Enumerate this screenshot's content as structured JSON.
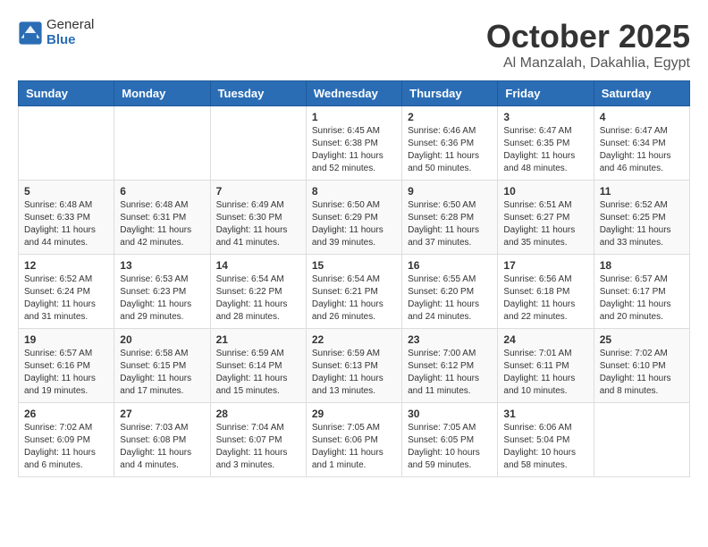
{
  "header": {
    "logo_general": "General",
    "logo_blue": "Blue",
    "month_title": "October 2025",
    "location": "Al Manzalah, Dakahlia, Egypt"
  },
  "days_of_week": [
    "Sunday",
    "Monday",
    "Tuesday",
    "Wednesday",
    "Thursday",
    "Friday",
    "Saturday"
  ],
  "weeks": [
    [
      {
        "day": "",
        "info": ""
      },
      {
        "day": "",
        "info": ""
      },
      {
        "day": "",
        "info": ""
      },
      {
        "day": "1",
        "info": "Sunrise: 6:45 AM\nSunset: 6:38 PM\nDaylight: 11 hours\nand 52 minutes."
      },
      {
        "day": "2",
        "info": "Sunrise: 6:46 AM\nSunset: 6:36 PM\nDaylight: 11 hours\nand 50 minutes."
      },
      {
        "day": "3",
        "info": "Sunrise: 6:47 AM\nSunset: 6:35 PM\nDaylight: 11 hours\nand 48 minutes."
      },
      {
        "day": "4",
        "info": "Sunrise: 6:47 AM\nSunset: 6:34 PM\nDaylight: 11 hours\nand 46 minutes."
      }
    ],
    [
      {
        "day": "5",
        "info": "Sunrise: 6:48 AM\nSunset: 6:33 PM\nDaylight: 11 hours\nand 44 minutes."
      },
      {
        "day": "6",
        "info": "Sunrise: 6:48 AM\nSunset: 6:31 PM\nDaylight: 11 hours\nand 42 minutes."
      },
      {
        "day": "7",
        "info": "Sunrise: 6:49 AM\nSunset: 6:30 PM\nDaylight: 11 hours\nand 41 minutes."
      },
      {
        "day": "8",
        "info": "Sunrise: 6:50 AM\nSunset: 6:29 PM\nDaylight: 11 hours\nand 39 minutes."
      },
      {
        "day": "9",
        "info": "Sunrise: 6:50 AM\nSunset: 6:28 PM\nDaylight: 11 hours\nand 37 minutes."
      },
      {
        "day": "10",
        "info": "Sunrise: 6:51 AM\nSunset: 6:27 PM\nDaylight: 11 hours\nand 35 minutes."
      },
      {
        "day": "11",
        "info": "Sunrise: 6:52 AM\nSunset: 6:25 PM\nDaylight: 11 hours\nand 33 minutes."
      }
    ],
    [
      {
        "day": "12",
        "info": "Sunrise: 6:52 AM\nSunset: 6:24 PM\nDaylight: 11 hours\nand 31 minutes."
      },
      {
        "day": "13",
        "info": "Sunrise: 6:53 AM\nSunset: 6:23 PM\nDaylight: 11 hours\nand 29 minutes."
      },
      {
        "day": "14",
        "info": "Sunrise: 6:54 AM\nSunset: 6:22 PM\nDaylight: 11 hours\nand 28 minutes."
      },
      {
        "day": "15",
        "info": "Sunrise: 6:54 AM\nSunset: 6:21 PM\nDaylight: 11 hours\nand 26 minutes."
      },
      {
        "day": "16",
        "info": "Sunrise: 6:55 AM\nSunset: 6:20 PM\nDaylight: 11 hours\nand 24 minutes."
      },
      {
        "day": "17",
        "info": "Sunrise: 6:56 AM\nSunset: 6:18 PM\nDaylight: 11 hours\nand 22 minutes."
      },
      {
        "day": "18",
        "info": "Sunrise: 6:57 AM\nSunset: 6:17 PM\nDaylight: 11 hours\nand 20 minutes."
      }
    ],
    [
      {
        "day": "19",
        "info": "Sunrise: 6:57 AM\nSunset: 6:16 PM\nDaylight: 11 hours\nand 19 minutes."
      },
      {
        "day": "20",
        "info": "Sunrise: 6:58 AM\nSunset: 6:15 PM\nDaylight: 11 hours\nand 17 minutes."
      },
      {
        "day": "21",
        "info": "Sunrise: 6:59 AM\nSunset: 6:14 PM\nDaylight: 11 hours\nand 15 minutes."
      },
      {
        "day": "22",
        "info": "Sunrise: 6:59 AM\nSunset: 6:13 PM\nDaylight: 11 hours\nand 13 minutes."
      },
      {
        "day": "23",
        "info": "Sunrise: 7:00 AM\nSunset: 6:12 PM\nDaylight: 11 hours\nand 11 minutes."
      },
      {
        "day": "24",
        "info": "Sunrise: 7:01 AM\nSunset: 6:11 PM\nDaylight: 11 hours\nand 10 minutes."
      },
      {
        "day": "25",
        "info": "Sunrise: 7:02 AM\nSunset: 6:10 PM\nDaylight: 11 hours\nand 8 minutes."
      }
    ],
    [
      {
        "day": "26",
        "info": "Sunrise: 7:02 AM\nSunset: 6:09 PM\nDaylight: 11 hours\nand 6 minutes."
      },
      {
        "day": "27",
        "info": "Sunrise: 7:03 AM\nSunset: 6:08 PM\nDaylight: 11 hours\nand 4 minutes."
      },
      {
        "day": "28",
        "info": "Sunrise: 7:04 AM\nSunset: 6:07 PM\nDaylight: 11 hours\nand 3 minutes."
      },
      {
        "day": "29",
        "info": "Sunrise: 7:05 AM\nSunset: 6:06 PM\nDaylight: 11 hours\nand 1 minute."
      },
      {
        "day": "30",
        "info": "Sunrise: 7:05 AM\nSunset: 6:05 PM\nDaylight: 10 hours\nand 59 minutes."
      },
      {
        "day": "31",
        "info": "Sunrise: 6:06 AM\nSunset: 5:04 PM\nDaylight: 10 hours\nand 58 minutes."
      },
      {
        "day": "",
        "info": ""
      }
    ]
  ]
}
